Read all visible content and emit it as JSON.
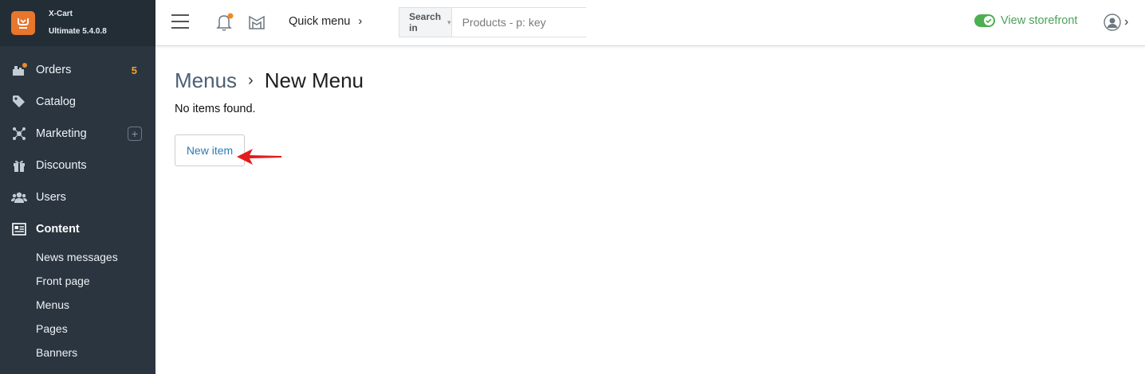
{
  "brand": {
    "name": "X-Cart",
    "version": "Ultimate 5.4.0.8"
  },
  "sidebar": {
    "items": [
      {
        "label": "Orders",
        "icon": "orders-icon",
        "badge": "5"
      },
      {
        "label": "Catalog",
        "icon": "tag-icon"
      },
      {
        "label": "Marketing",
        "icon": "network-icon"
      },
      {
        "label": "Discounts",
        "icon": "gift-icon"
      },
      {
        "label": "Users",
        "icon": "users-icon"
      },
      {
        "label": "Content",
        "icon": "newspaper-icon"
      }
    ],
    "content_sub": [
      "News messages",
      "Front page",
      "Menus",
      "Pages",
      "Banners"
    ]
  },
  "topbar": {
    "quick_menu": "Quick menu",
    "search_in": "Search in",
    "search_placeholder": "Products - p: key",
    "view_storefront": "View storefront"
  },
  "main": {
    "breadcrumb_parent": "Menus",
    "breadcrumb_current": "New Menu",
    "empty_text": "No items found.",
    "new_item_label": "New item"
  },
  "colors": {
    "sidebar_bg": "#2a3540",
    "accent_orange": "#e8762c",
    "storefront_green": "#4aa35a",
    "link_blue": "#2b7bb9",
    "badge_orange": "#f5a623",
    "arrow_red": "#e31b1b"
  }
}
